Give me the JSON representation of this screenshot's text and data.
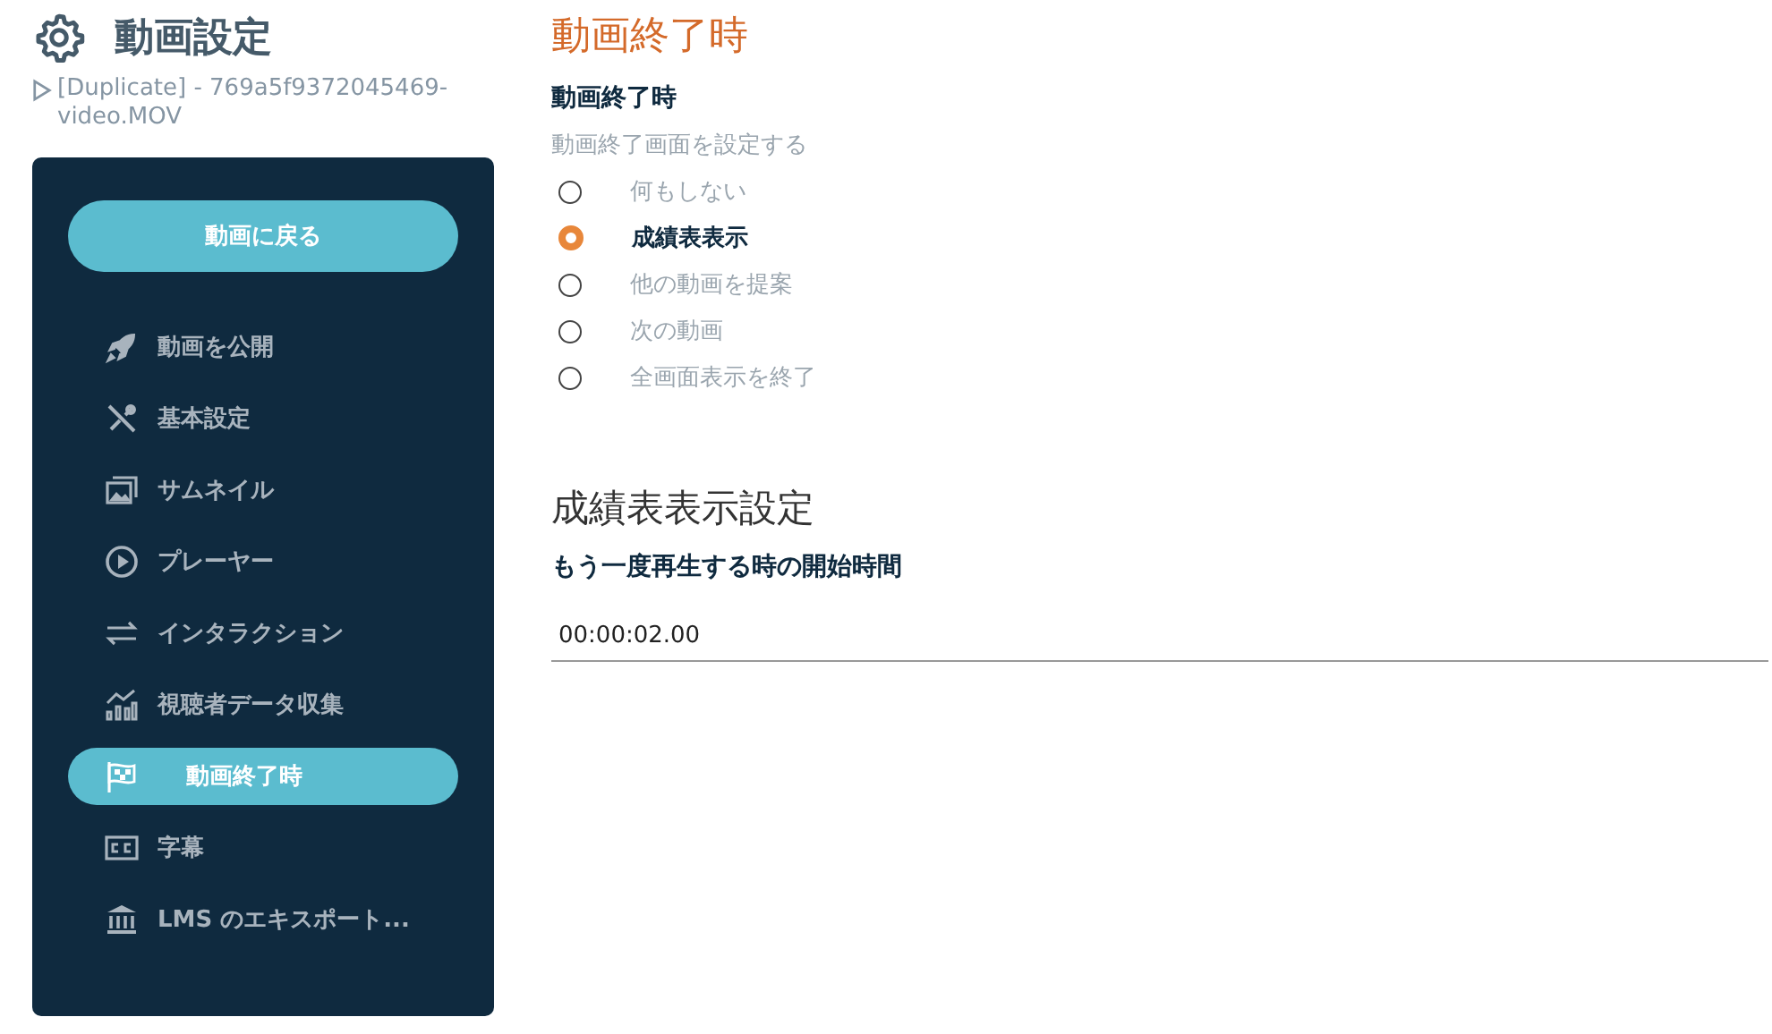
{
  "header": {
    "title": "動画設定",
    "subtitle": "[Duplicate] - 769a5f9372045469-video.MOV"
  },
  "sidebar": {
    "back_button": "動画に戻る",
    "items": [
      {
        "label": "動画を公開",
        "selected": false
      },
      {
        "label": "基本設定",
        "selected": false
      },
      {
        "label": "サムネイル",
        "selected": false
      },
      {
        "label": "プレーヤー",
        "selected": false
      },
      {
        "label": "インタラクション",
        "selected": false
      },
      {
        "label": "視聴者データ収集",
        "selected": false
      },
      {
        "label": "動画終了時",
        "selected": true
      },
      {
        "label": "字幕",
        "selected": false
      },
      {
        "label": "LMS のエキスポート...",
        "selected": false
      }
    ]
  },
  "page_title": "動画終了時",
  "end_section": {
    "label": "動画終了時",
    "hint": "動画終了画面を設定する",
    "options": [
      {
        "label": "何もしない",
        "selected": false
      },
      {
        "label": "成績表表示",
        "selected": true
      },
      {
        "label": "他の動画を提案",
        "selected": false
      },
      {
        "label": "次の動画",
        "selected": false
      },
      {
        "label": "全画面表示を終了",
        "selected": false
      }
    ]
  },
  "score_section": {
    "title": "成績表表示設定",
    "label": "もう一度再生する時の開始時間",
    "value": "00:00:02.00"
  }
}
